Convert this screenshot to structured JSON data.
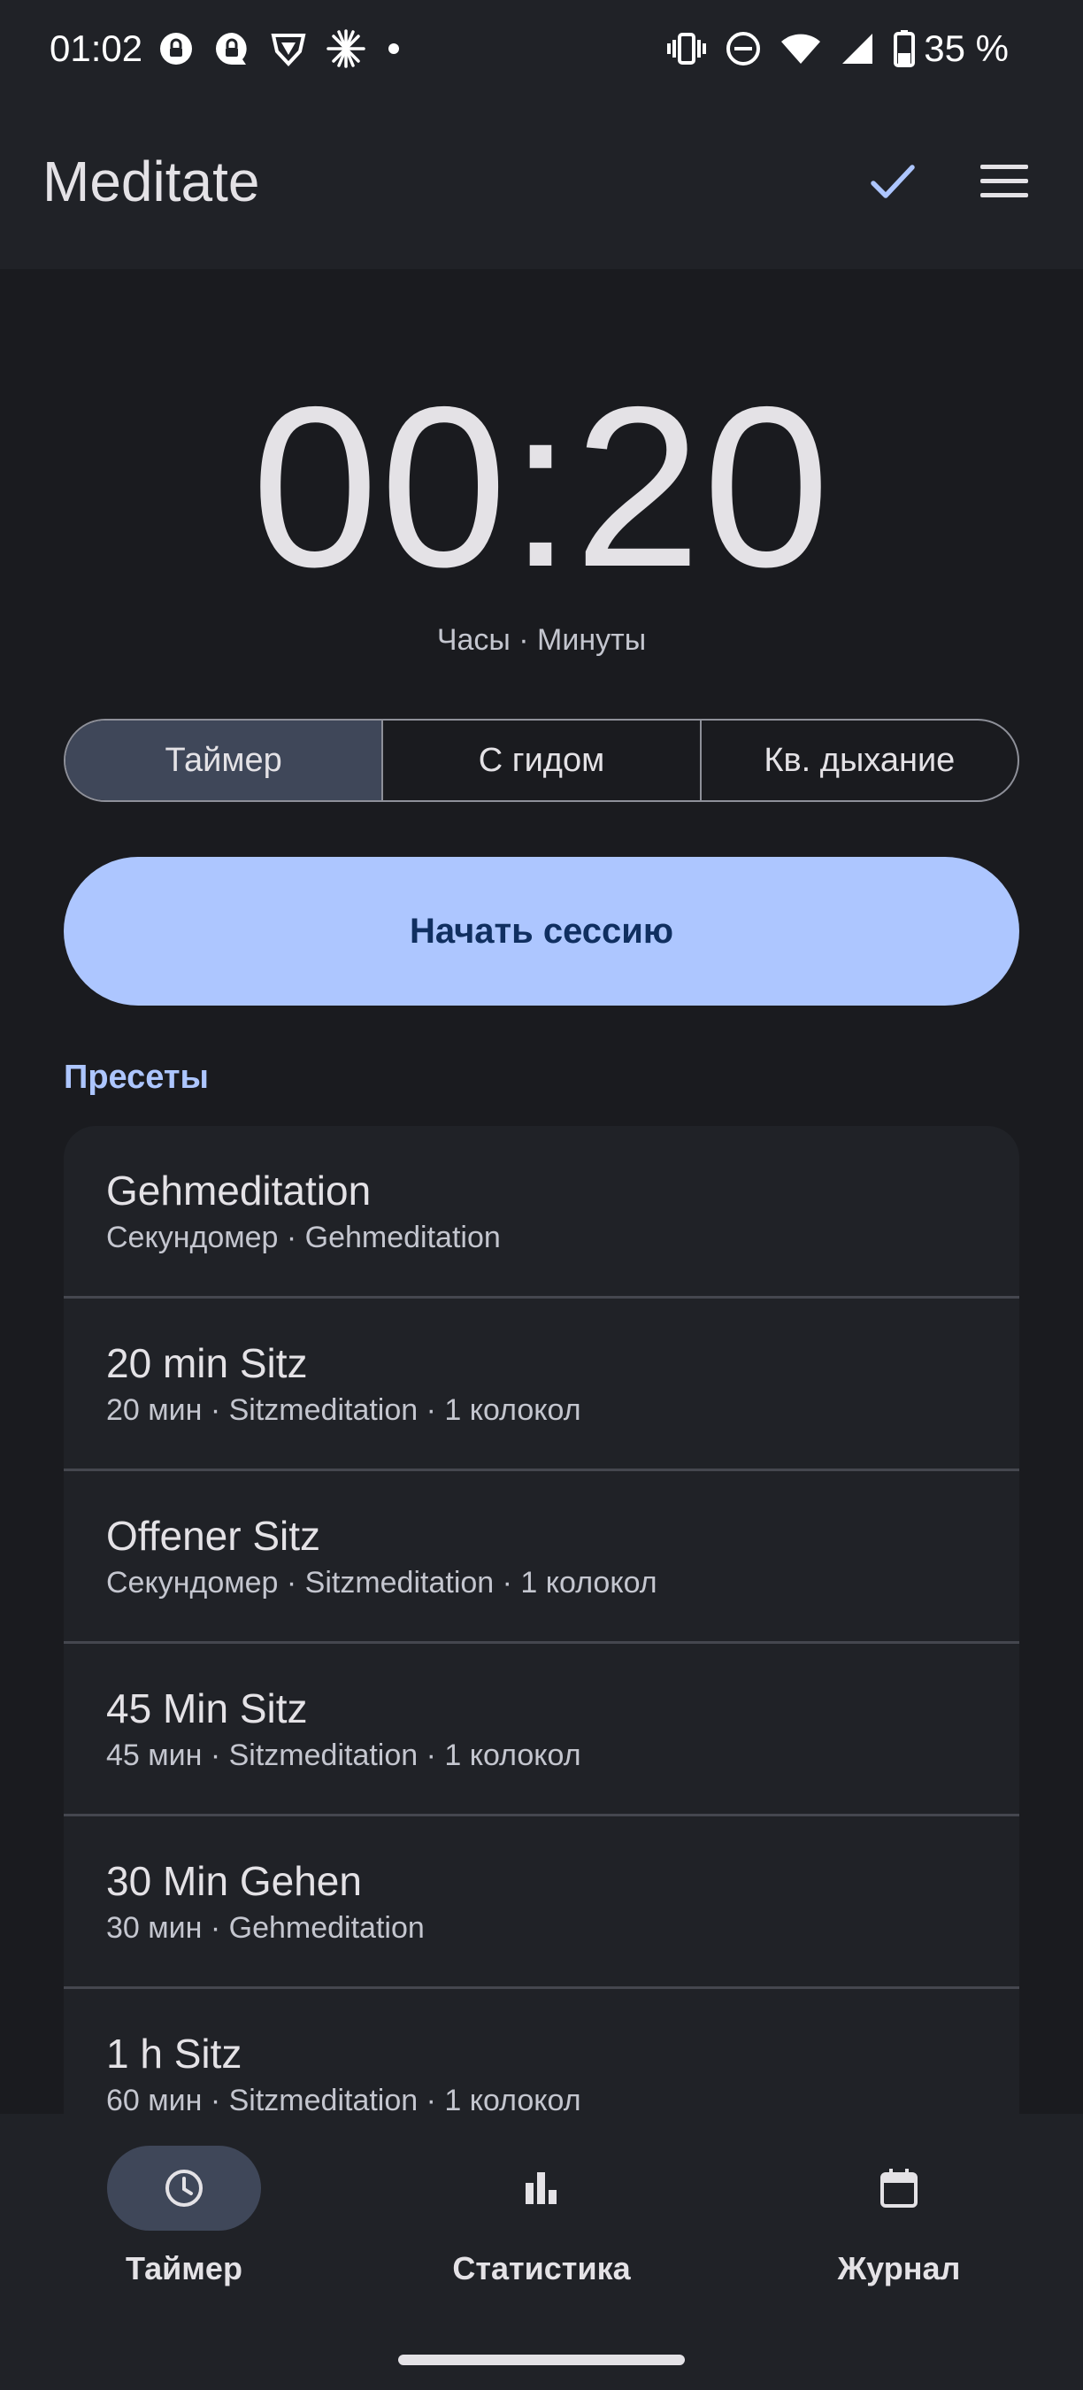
{
  "status_bar": {
    "time": "01:02",
    "battery": "35 %"
  },
  "app_bar": {
    "title": "Meditate",
    "check_icon": "check-icon",
    "menu_icon": "menu-icon"
  },
  "timer": {
    "display": "00:20",
    "units": "Часы · Минуты"
  },
  "modes": [
    {
      "label": "Таймер",
      "selected": true
    },
    {
      "label": "С гидом",
      "selected": false
    },
    {
      "label": "Кв. дыхание",
      "selected": false
    }
  ],
  "start_button": "Начать сессию",
  "presets": {
    "title": "Пресеты",
    "items": [
      {
        "name": "Gehmeditation",
        "detail": "Секундомер · Gehmeditation"
      },
      {
        "name": "20 min Sitz",
        "detail": "20 мин · Sitzmeditation · 1 колокол"
      },
      {
        "name": "Offener Sitz",
        "detail": "Секундомер · Sitzmeditation · 1 колокол"
      },
      {
        "name": "45 Min Sitz",
        "detail": "45 мин · Sitzmeditation · 1 колокол"
      },
      {
        "name": "30 Min Gehen",
        "detail": "30 мин · Gehmeditation"
      },
      {
        "name": "1 h Sitz",
        "detail": "60 мин · Sitzmeditation · 1 колокол"
      }
    ]
  },
  "bottom_nav": [
    {
      "label": "Таймер",
      "icon": "clock-icon",
      "active": true
    },
    {
      "label": "Статистика",
      "icon": "bar-chart-icon",
      "active": false
    },
    {
      "label": "Журнал",
      "icon": "calendar-icon",
      "active": false
    }
  ],
  "colors": {
    "background": "#1a1b1f",
    "surface": "#202227",
    "primary": "#adc6ff",
    "on_primary": "#102f60",
    "selected_container": "#3f4759"
  }
}
